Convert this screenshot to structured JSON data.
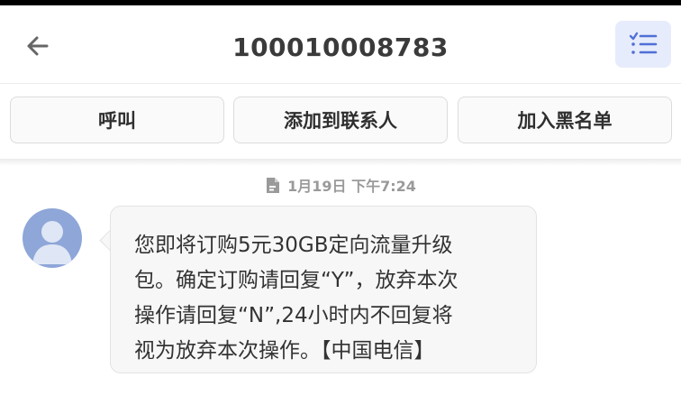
{
  "header": {
    "title": "100010008783",
    "back_icon": "arrow-left-icon",
    "menu_icon": "checklist-icon"
  },
  "actions": {
    "call_label": "呼叫",
    "add_contact_label": "添加到联系人",
    "blacklist_label": "加入黑名单"
  },
  "conversation": {
    "timestamp": "1月19日 下午7:24",
    "timestamp_icon": "sms-document-icon",
    "message": {
      "avatar_icon": "person-avatar-icon",
      "lines": [
        "您即将订购5元30GB定向流量升级",
        "包。确定订购请回复“Y”，放弃本次",
        "操作请回复“N”,24小时内不回复将",
        "视为放弃本次操作。【中国电信】"
      ]
    }
  },
  "colors": {
    "accent_bg": "#e6ecfb",
    "accent": "#4f6fd8",
    "avatar_bg": "#8ea6d8",
    "bubble_bg": "#f7f7f7"
  }
}
